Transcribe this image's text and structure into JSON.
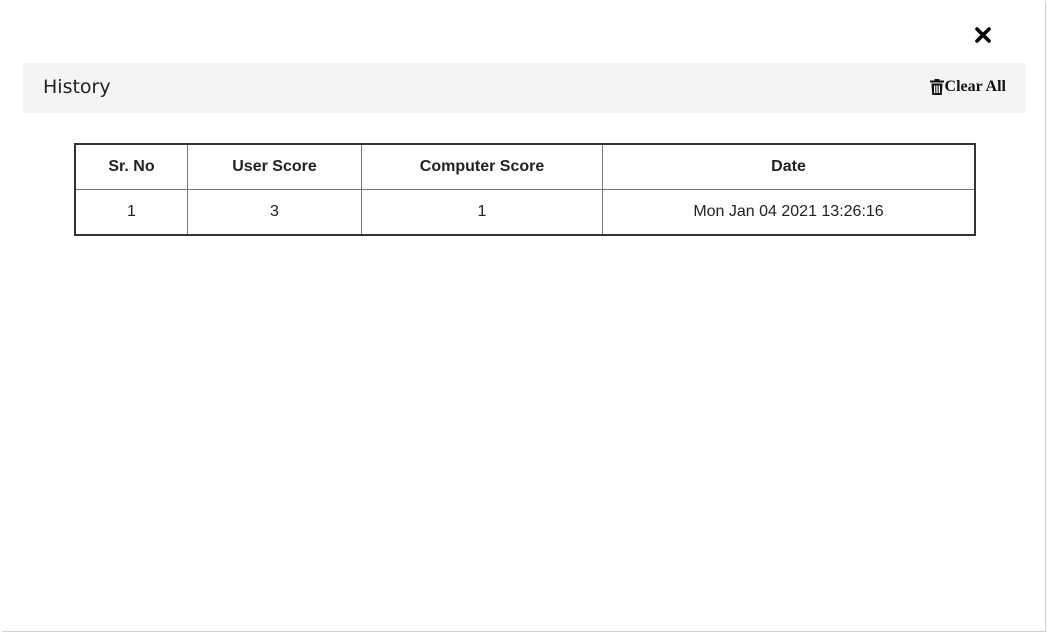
{
  "modal": {
    "close_icon": "close-icon",
    "title": "History",
    "clear_all_label": "Clear All",
    "clear_all_icon": "trash-icon"
  },
  "table": {
    "headers": [
      "Sr. No",
      "User Score",
      "Computer Score",
      "Date"
    ],
    "rows": [
      {
        "sr_no": "1",
        "user_score": "3",
        "computer_score": "1",
        "date": "Mon Jan 04 2021 13:26:16"
      }
    ]
  }
}
